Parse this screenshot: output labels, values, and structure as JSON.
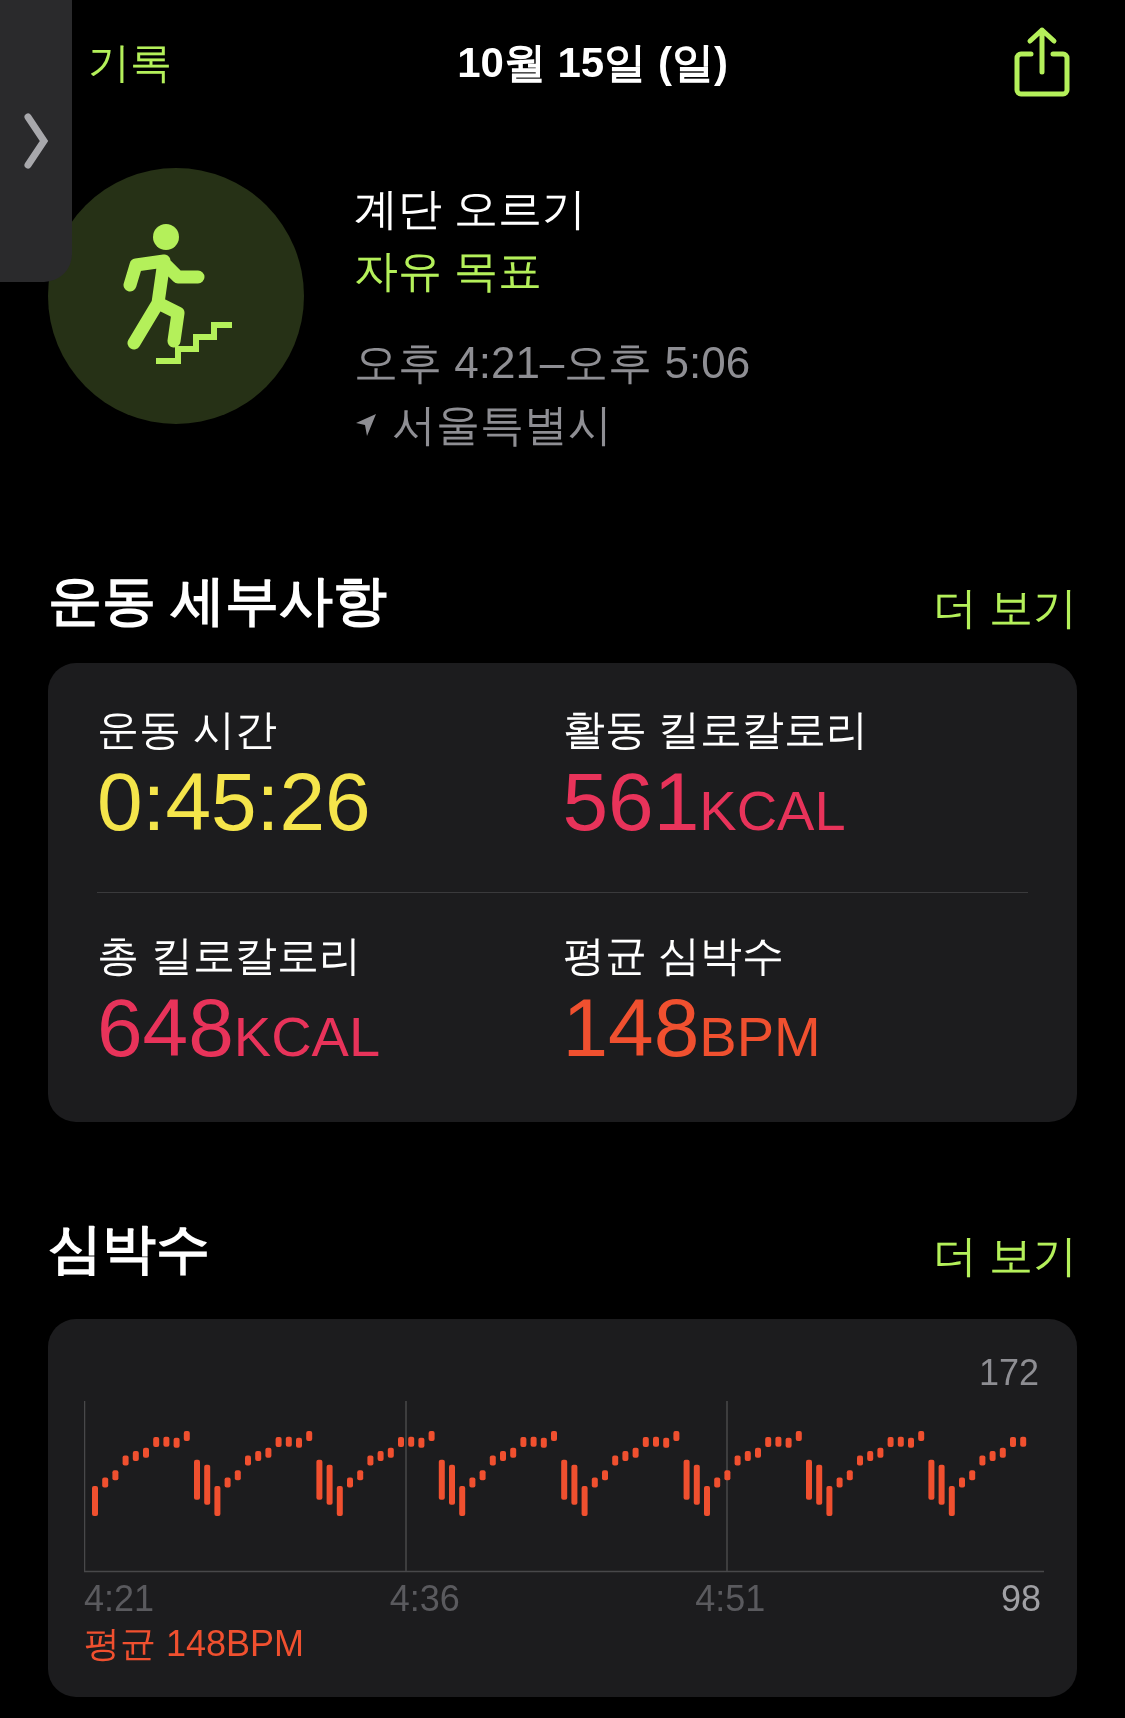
{
  "nav": {
    "back": "기록",
    "title": "10월 15일 (일)"
  },
  "workout": {
    "name": "계단 오르기",
    "goal": "자유 목표",
    "time": "오후 4:21–오후 5:06",
    "location": "서울특별시"
  },
  "details": {
    "title": "운동 세부사항",
    "more": "더 보기",
    "metrics": [
      {
        "label": "운동 시간",
        "value": "0:45:26",
        "color": "#f5e54b"
      },
      {
        "label": "활동 킬로칼로리",
        "value": "561",
        "unit": "KCAL",
        "color": "#e8335a"
      },
      {
        "label": "총 킬로칼로리",
        "value": "648",
        "unit": "KCAL",
        "color": "#e8335a"
      },
      {
        "label": "평균 심박수",
        "value": "148",
        "unit": "BPM",
        "color": "#f0502f"
      }
    ]
  },
  "heart_rate": {
    "title": "심박수",
    "more": "더 보기",
    "max_label": "172",
    "min_label": "98",
    "x_labels": [
      "4:21",
      "4:36",
      "4:51"
    ],
    "average": "평균 148BPM"
  }
}
